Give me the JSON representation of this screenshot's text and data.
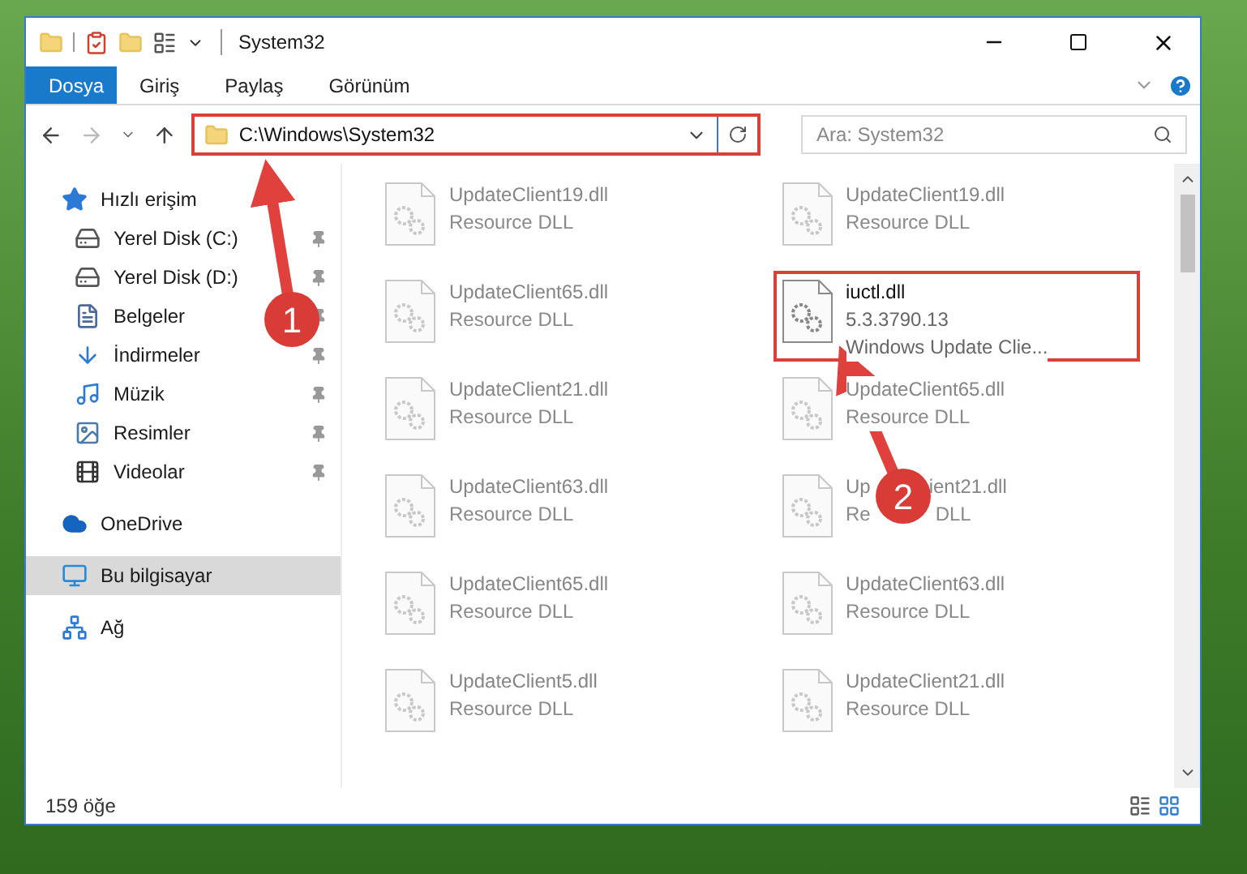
{
  "window": {
    "title": "System32"
  },
  "ribbon": {
    "tabs": [
      {
        "label": "Dosya",
        "selected": true
      },
      {
        "label": "Giriş",
        "selected": false
      },
      {
        "label": "Paylaş",
        "selected": false
      },
      {
        "label": "Görünüm",
        "selected": false
      }
    ]
  },
  "address": {
    "path": "C:\\Windows\\System32",
    "highlighted": true
  },
  "search": {
    "placeholder": "Ara: System32"
  },
  "sidebar": {
    "items": [
      {
        "label": "Hızlı erişim",
        "kind": "star",
        "selected": false,
        "children": [
          {
            "label": "Yerel Disk (C:)",
            "kind": "system-drive",
            "selected": false,
            "pinned": true
          },
          {
            "label": "Yerel Disk (D:)",
            "kind": "drive",
            "selected": false,
            "pinned": true
          },
          {
            "label": "Belgeler",
            "kind": "documents",
            "selected": false,
            "pinned": true
          },
          {
            "label": "İndirmeler",
            "kind": "downloads",
            "selected": false,
            "pinned": true
          },
          {
            "label": "Müzik",
            "kind": "music",
            "selected": false,
            "pinned": true
          },
          {
            "label": "Resimler",
            "kind": "pictures",
            "selected": false,
            "pinned": true
          },
          {
            "label": "Videolar",
            "kind": "videos",
            "selected": false,
            "pinned": true
          }
        ]
      },
      {
        "label": "OneDrive",
        "kind": "cloud",
        "selected": false
      },
      {
        "label": "Bu bilgisayar",
        "kind": "computer",
        "selected": true
      },
      {
        "label": "Ağ",
        "kind": "network",
        "selected": false
      }
    ]
  },
  "files": [
    {
      "name": "UpdateClient19.dll",
      "lines": [
        "Resource DLL"
      ],
      "blurred": true,
      "highlighted": false
    },
    {
      "name": "UpdateClient19.dll",
      "lines": [
        "Resource DLL"
      ],
      "blurred": true,
      "highlighted": false
    },
    {
      "name": "UpdateClient65.dll",
      "lines": [
        "Resource DLL"
      ],
      "blurred": true,
      "highlighted": false
    },
    {
      "name": "iuctl.dll",
      "lines": [
        "5.3.3790.13",
        "Windows Update Clie..."
      ],
      "blurred": false,
      "highlighted": true
    },
    {
      "name": "UpdateClient21.dll",
      "lines": [
        "Resource DLL"
      ],
      "blurred": true,
      "highlighted": false
    },
    {
      "name": "UpdateClient65.dll",
      "lines": [
        "Resource DLL"
      ],
      "blurred": true,
      "highlighted": false
    },
    {
      "name": "UpdateClient63.dll",
      "lines": [
        "Resource DLL"
      ],
      "blurred": true,
      "highlighted": false
    },
    {
      "name_fragments": [
        "Up",
        "ient21.dll"
      ],
      "line_fragments": [
        "Re",
        "DLL"
      ],
      "blurred": true,
      "highlighted": false
    },
    {
      "name": "UpdateClient65.dll",
      "lines": [
        "Resource DLL"
      ],
      "blurred": true,
      "highlighted": false
    },
    {
      "name": "UpdateClient63.dll",
      "lines": [
        "Resource DLL"
      ],
      "blurred": true,
      "highlighted": false
    },
    {
      "name": "UpdateClient5.dll",
      "lines": [
        "Resource DLL"
      ],
      "blurred": true,
      "highlighted": false
    },
    {
      "name": "UpdateClient21.dll",
      "lines": [
        "Resource DLL"
      ],
      "blurred": true,
      "highlighted": false
    }
  ],
  "status_bar": {
    "item_count": "159 öğe"
  },
  "annotations": [
    {
      "label": "1"
    },
    {
      "label": "2"
    }
  ]
}
